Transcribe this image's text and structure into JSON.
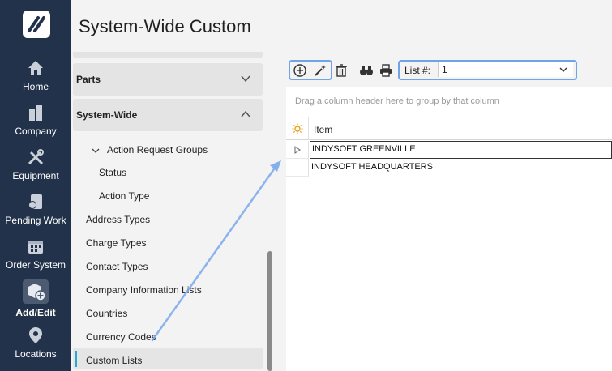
{
  "page": {
    "title": "System-Wide Custom"
  },
  "rail": {
    "items": [
      {
        "label": "Home",
        "icon": "home-icon"
      },
      {
        "label": "Company",
        "icon": "company-icon"
      },
      {
        "label": "Equipment",
        "icon": "tools-icon"
      },
      {
        "label": "Pending Work",
        "icon": "pending-work-icon"
      },
      {
        "label": "Order System",
        "icon": "calendar-icon"
      },
      {
        "label": "Add/Edit",
        "icon": "add-edit-icon",
        "active": true
      },
      {
        "label": "Locations",
        "icon": "location-pin-icon"
      }
    ]
  },
  "tree": {
    "sections": [
      {
        "label": "Parts",
        "expanded": false
      },
      {
        "label": "System-Wide",
        "expanded": true
      }
    ],
    "group": {
      "label": "Action Request Groups",
      "children": [
        "Status",
        "Action Type"
      ]
    },
    "items": [
      "Address Types",
      "Charge Types",
      "Contact Types",
      "Company Information Lists",
      "Countries",
      "Currency Codes",
      "Custom Lists"
    ],
    "selected": "Custom Lists"
  },
  "toolbar": {
    "list_label": "List #:",
    "list_value": "1"
  },
  "grid": {
    "group_hint": "Drag a column header here to group by that column",
    "columns": [
      "Item"
    ],
    "rows": [
      "INDYSOFT GREENVILLE",
      "INDYSOFT HEADQUARTERS"
    ]
  },
  "colors": {
    "rail_bg": "#22324a",
    "highlight_border": "#6ea4e8",
    "selection_bar": "#2aa7d9"
  }
}
